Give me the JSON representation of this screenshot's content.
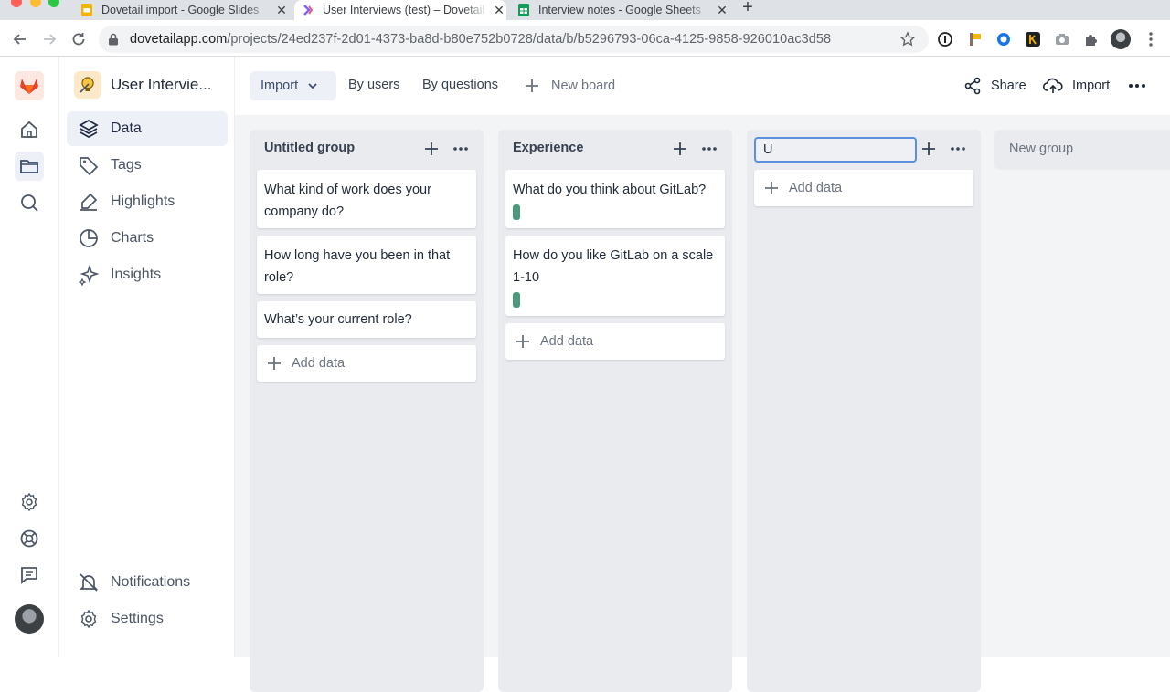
{
  "browser": {
    "tabs": [
      {
        "title": "Dovetail import - Google Slides",
        "favicon": "google-slides-icon",
        "color": "#f4b400"
      },
      {
        "title": "User Interviews (test) – Dovetail",
        "favicon": "dovetail-icon",
        "active": true
      },
      {
        "title": "Interview notes - Google Sheets",
        "favicon": "google-sheets-icon",
        "color": "#0f9d58"
      }
    ],
    "close_glyph": "✕",
    "new_tab_glyph": "+",
    "url_host": "dovetailapp.com",
    "url_path": "/projects/24ed237f-2d01-4373-ba8d-b80e752b0728/data/b/b5296793-06ca-4125-9858-926010ac3d58"
  },
  "project": {
    "name": "User Intervie..."
  },
  "sidebar": {
    "items": [
      {
        "label": "Data",
        "icon": "layers-icon",
        "active": true
      },
      {
        "label": "Tags",
        "icon": "tag-icon"
      },
      {
        "label": "Highlights",
        "icon": "highlighter-icon"
      },
      {
        "label": "Charts",
        "icon": "pie-chart-icon"
      },
      {
        "label": "Insights",
        "icon": "sparkle-icon"
      }
    ],
    "bottom": [
      {
        "label": "Notifications",
        "icon": "bell-off-icon"
      },
      {
        "label": "Settings",
        "icon": "gear-icon"
      }
    ]
  },
  "toolbar": {
    "import_label": "Import",
    "by_users": "By users",
    "by_questions": "By questions",
    "new_board": "New board",
    "share": "Share",
    "import_right": "Import"
  },
  "board": {
    "groups": [
      {
        "title": "Untitled group",
        "cards": [
          {
            "text": "What kind of work does your company do?"
          },
          {
            "text": "How long have you been in that role?"
          },
          {
            "text": "What’s your current role?"
          }
        ],
        "add_label": "Add data"
      },
      {
        "title": "Experience",
        "cards": [
          {
            "text": "What do you think about GitLab?",
            "tag_color": "#4c9a7e"
          },
          {
            "text": "How do you like GitLab on a scale 1-10",
            "tag_color": "#4c9a7e"
          }
        ],
        "add_label": "Add data"
      },
      {
        "title_input_value": "U",
        "cards": [],
        "add_label": "Add data"
      }
    ],
    "new_group_label": "New group"
  },
  "colors": {
    "accent": "#5b8fe0",
    "active_bg": "#eef0f7",
    "board_bg": "#f3f4f6",
    "logo": "#e24329"
  }
}
